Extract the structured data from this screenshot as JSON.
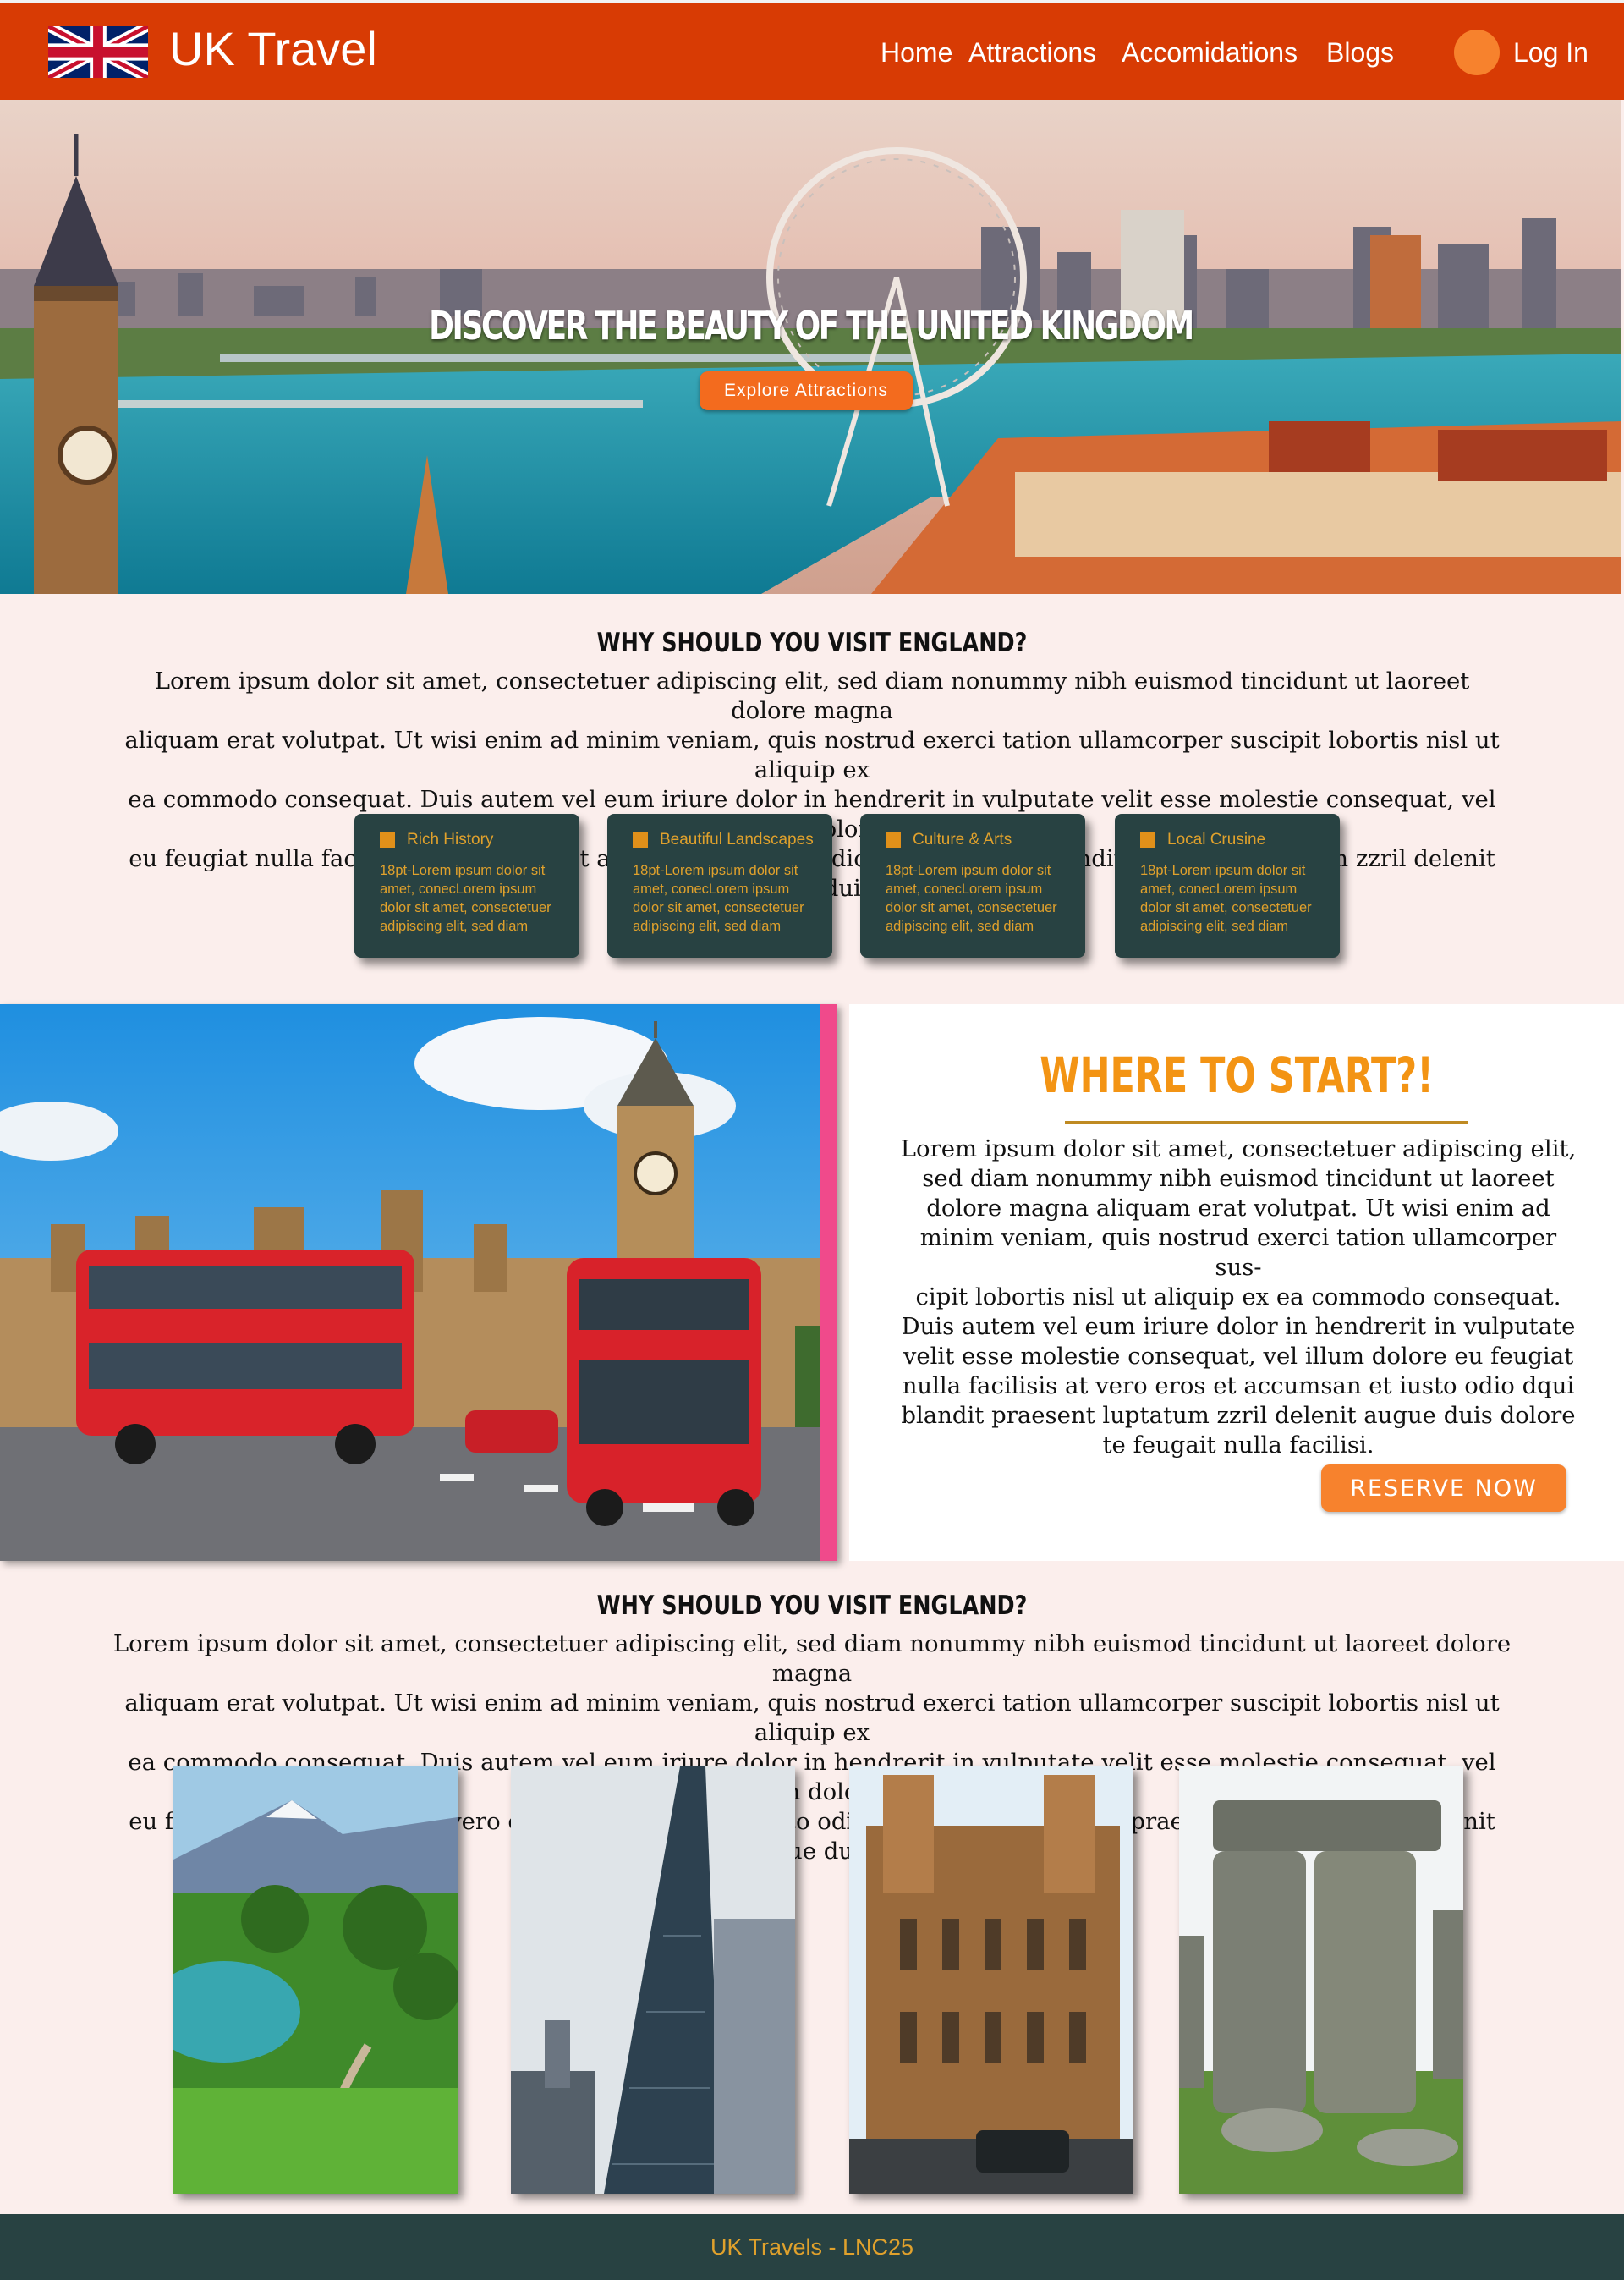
{
  "nav": {
    "brand": "UK Travel",
    "links": [
      "Home",
      "Attractions",
      "Accomidations",
      "Blogs"
    ],
    "login": "Log In",
    "color": "#d83b04"
  },
  "hero": {
    "title": "DISCOVER THE BEAUTY OF THE UNITED KINGDOM",
    "button": "Explore Attractions"
  },
  "why": {
    "title": "WHY SHOULD YOU VISIT ENGLAND?",
    "lines": [
      "Lorem ipsum dolor sit amet, consectetuer adipiscing elit, sed diam nonummy nibh euismod tincidunt ut laoreet dolore magna",
      "aliquam erat volutpat. Ut wisi enim ad minim veniam, quis nostrud exerci tation ullamcorper suscipit lobortis nisl ut aliquip ex",
      "ea commodo consequat. Duis autem vel eum iriure dolor in hendrerit in vulputate velit esse molestie consequat, vel illum dolore",
      "eu feugiat nulla facilisis at vero eros et accumsan et iusto odio dignissim qui blandit praesent luptatum zzril delenit augue duis."
    ]
  },
  "cards": [
    {
      "title": "Rich History",
      "lines": [
        "18pt-Lorem ipsum dolor sit",
        "amet, conecLorem ipsum",
        "dolor sit amet, consectetuer",
        "adipiscing elit, sed diam"
      ]
    },
    {
      "title": "Beautiful Landscapes",
      "lines": [
        "18pt-Lorem ipsum dolor sit",
        "amet, conecLorem ipsum",
        "dolor sit amet, consectetuer",
        "adipiscing elit, sed diam"
      ]
    },
    {
      "title": "Culture & Arts",
      "lines": [
        "18pt-Lorem ipsum dolor sit",
        "amet, conecLorem ipsum",
        "dolor sit amet, consectetuer",
        "adipiscing elit, sed diam"
      ]
    },
    {
      "title": "Local Crusine",
      "lines": [
        "18pt-Lorem ipsum dolor sit",
        "amet, conecLorem ipsum",
        "dolor sit amet, consectetuer",
        "adipiscing elit, sed diam"
      ]
    }
  ],
  "start": {
    "title": "WHERE TO START?!",
    "lines": [
      "Lorem ipsum dolor sit amet, consectetuer adipiscing elit,",
      "sed diam nonummy nibh euismod tincidunt ut laoreet",
      "dolore magna aliquam erat volutpat. Ut wisi enim ad",
      "minim veniam, quis nostrud exerci tation ullamcorper sus-",
      "cipit lobortis nisl ut aliquip ex ea commodo consequat.",
      "Duis autem vel eum iriure dolor in hendrerit in vulputate",
      "velit esse molestie consequat, vel illum dolore eu feugiat",
      "nulla facilisis at vero eros et accumsan et iusto odio dqui",
      "blandit praesent luptatum zzril delenit augue duis dolore",
      "te feugait nulla facilisi."
    ],
    "button": "RESERVE NOW"
  },
  "why2": {
    "title": "WHY SHOULD YOU VISIT ENGLAND?",
    "lines": [
      "Lorem ipsum dolor sit amet, consectetuer adipiscing elit, sed diam nonummy nibh euismod tincidunt ut laoreet dolore magna",
      "aliquam erat volutpat. Ut wisi enim ad minim veniam, quis nostrud exerci tation ullamcorper suscipit lobortis nisl ut aliquip ex",
      "ea commodo consequat. Duis autem vel eum iriure dolor in hendrerit in vulputate velit esse molestie consequat, vel illum dolore",
      "eu feugiat nulla facilisis at vero eros et accumsan et iusto odio dignissim qui blandit praesent luptatum zzril delenit augue duis."
    ]
  },
  "footer": {
    "text": "UK Travels - LNC25"
  },
  "colors": {
    "accent": "#f7822d",
    "card": "#284242",
    "gold": "#e0a12c",
    "background": "#fbeeec"
  }
}
